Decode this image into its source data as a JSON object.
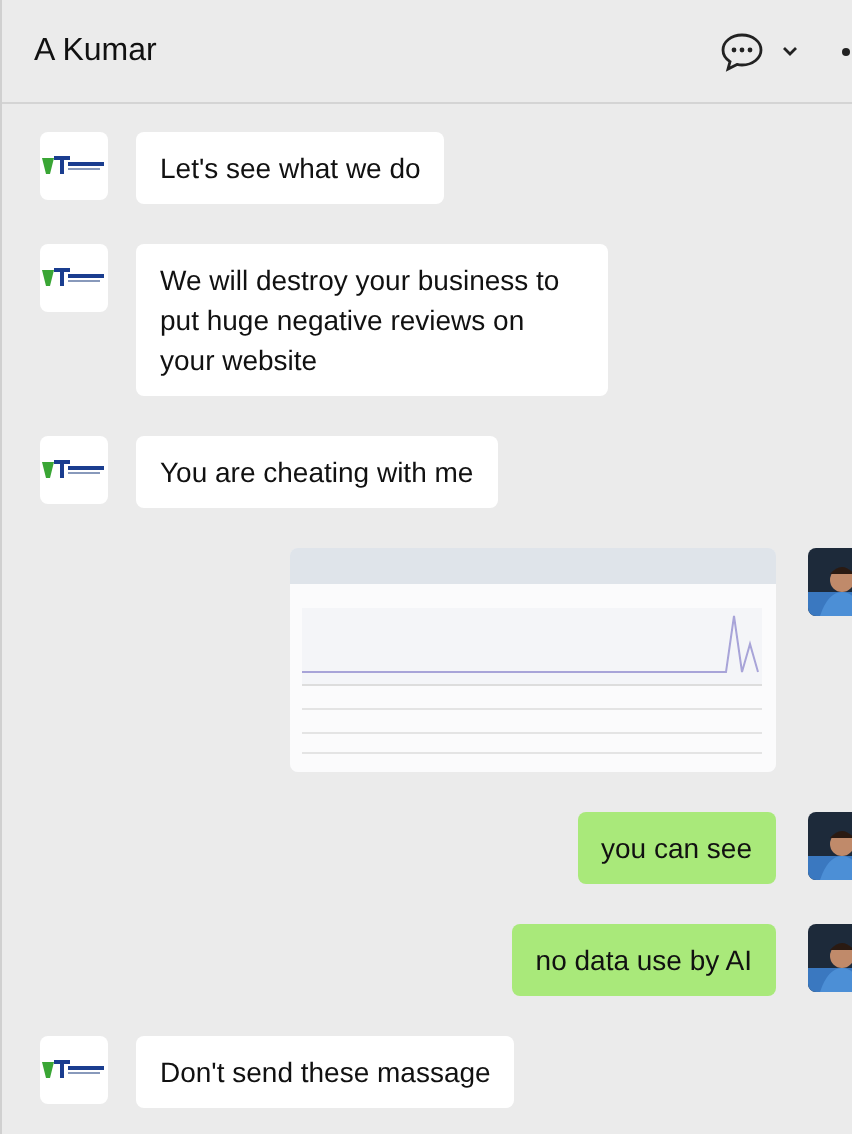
{
  "header": {
    "title": "A Kumar"
  },
  "messages": [
    {
      "outgoing": false,
      "kind": "text",
      "text": "Let's see what we do"
    },
    {
      "outgoing": false,
      "kind": "text",
      "text": "We will destroy your business to put huge negative reviews on your website"
    },
    {
      "outgoing": false,
      "kind": "text",
      "text": "You are cheating with me"
    },
    {
      "outgoing": true,
      "kind": "picture"
    },
    {
      "outgoing": true,
      "kind": "text",
      "text": "you can see"
    },
    {
      "outgoing": true,
      "kind": "text",
      "text": "no data use by AI"
    },
    {
      "outgoing": false,
      "kind": "text",
      "text": "Don't send these massage"
    }
  ]
}
